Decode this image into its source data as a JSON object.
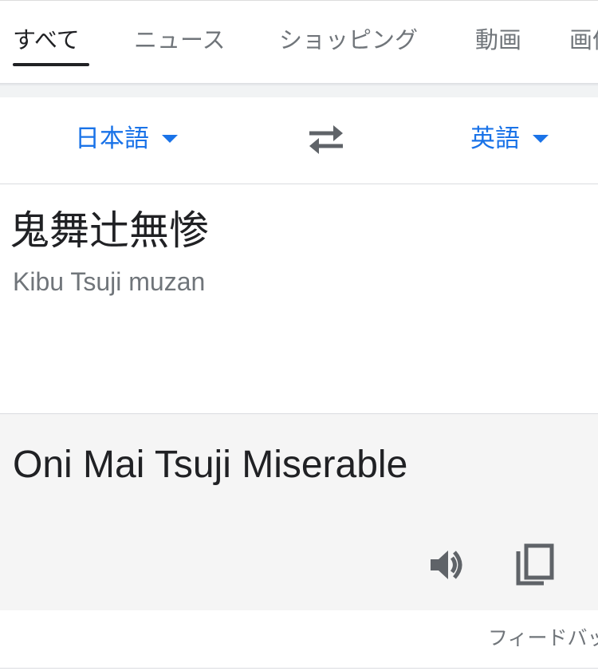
{
  "tabs": [
    {
      "label": "すべて",
      "active": true
    },
    {
      "label": "ニュース"
    },
    {
      "label": "ショッピング"
    },
    {
      "label": "動画"
    },
    {
      "label": "画像"
    }
  ],
  "translate": {
    "source_lang": "日本語",
    "target_lang": "英語",
    "source_text": "鬼舞辻無惨",
    "source_romanization": "Kibu Tsuji muzan",
    "result_text": "Oni Mai Tsuji Miserable"
  },
  "icons": {
    "swap": "swap-arrows-icon",
    "speaker": "speaker-icon",
    "copy": "copy-icon",
    "dropdown": "caret-down-icon"
  },
  "footer": {
    "feedback": "フィードバック"
  },
  "colors": {
    "accent": "#1a73e8",
    "text": "#202124",
    "secondary": "#70757a",
    "result_bg": "#f5f5f5"
  }
}
